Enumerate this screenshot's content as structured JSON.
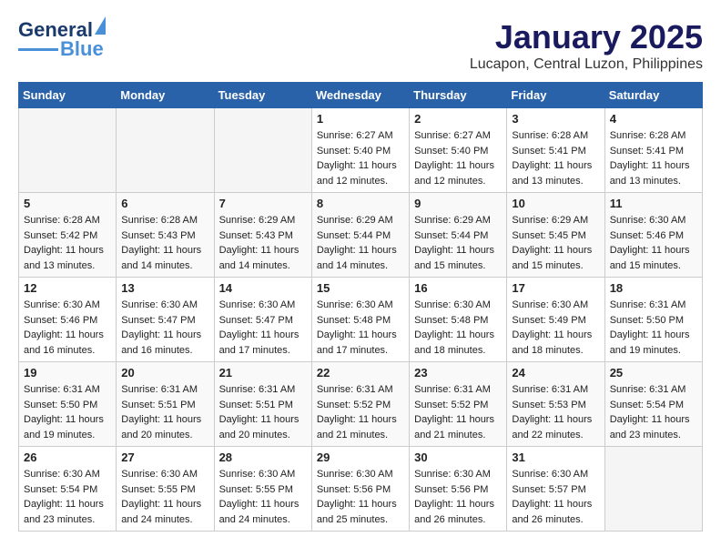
{
  "header": {
    "logo": {
      "general": "General",
      "blue": "Blue"
    },
    "title": "January 2025",
    "location": "Lucapon, Central Luzon, Philippines"
  },
  "weekdays": [
    "Sunday",
    "Monday",
    "Tuesday",
    "Wednesday",
    "Thursday",
    "Friday",
    "Saturday"
  ],
  "weeks": [
    [
      {
        "day": "",
        "empty": true
      },
      {
        "day": "",
        "empty": true
      },
      {
        "day": "",
        "empty": true
      },
      {
        "day": "1",
        "sunrise": "6:27 AM",
        "sunset": "5:40 PM",
        "daylight": "11 hours and 12 minutes."
      },
      {
        "day": "2",
        "sunrise": "6:27 AM",
        "sunset": "5:40 PM",
        "daylight": "11 hours and 12 minutes."
      },
      {
        "day": "3",
        "sunrise": "6:28 AM",
        "sunset": "5:41 PM",
        "daylight": "11 hours and 13 minutes."
      },
      {
        "day": "4",
        "sunrise": "6:28 AM",
        "sunset": "5:41 PM",
        "daylight": "11 hours and 13 minutes."
      }
    ],
    [
      {
        "day": "5",
        "sunrise": "6:28 AM",
        "sunset": "5:42 PM",
        "daylight": "11 hours and 13 minutes."
      },
      {
        "day": "6",
        "sunrise": "6:28 AM",
        "sunset": "5:43 PM",
        "daylight": "11 hours and 14 minutes."
      },
      {
        "day": "7",
        "sunrise": "6:29 AM",
        "sunset": "5:43 PM",
        "daylight": "11 hours and 14 minutes."
      },
      {
        "day": "8",
        "sunrise": "6:29 AM",
        "sunset": "5:44 PM",
        "daylight": "11 hours and 14 minutes."
      },
      {
        "day": "9",
        "sunrise": "6:29 AM",
        "sunset": "5:44 PM",
        "daylight": "11 hours and 15 minutes."
      },
      {
        "day": "10",
        "sunrise": "6:29 AM",
        "sunset": "5:45 PM",
        "daylight": "11 hours and 15 minutes."
      },
      {
        "day": "11",
        "sunrise": "6:30 AM",
        "sunset": "5:46 PM",
        "daylight": "11 hours and 15 minutes."
      }
    ],
    [
      {
        "day": "12",
        "sunrise": "6:30 AM",
        "sunset": "5:46 PM",
        "daylight": "11 hours and 16 minutes."
      },
      {
        "day": "13",
        "sunrise": "6:30 AM",
        "sunset": "5:47 PM",
        "daylight": "11 hours and 16 minutes."
      },
      {
        "day": "14",
        "sunrise": "6:30 AM",
        "sunset": "5:47 PM",
        "daylight": "11 hours and 17 minutes."
      },
      {
        "day": "15",
        "sunrise": "6:30 AM",
        "sunset": "5:48 PM",
        "daylight": "11 hours and 17 minutes."
      },
      {
        "day": "16",
        "sunrise": "6:30 AM",
        "sunset": "5:48 PM",
        "daylight": "11 hours and 18 minutes."
      },
      {
        "day": "17",
        "sunrise": "6:30 AM",
        "sunset": "5:49 PM",
        "daylight": "11 hours and 18 minutes."
      },
      {
        "day": "18",
        "sunrise": "6:31 AM",
        "sunset": "5:50 PM",
        "daylight": "11 hours and 19 minutes."
      }
    ],
    [
      {
        "day": "19",
        "sunrise": "6:31 AM",
        "sunset": "5:50 PM",
        "daylight": "11 hours and 19 minutes."
      },
      {
        "day": "20",
        "sunrise": "6:31 AM",
        "sunset": "5:51 PM",
        "daylight": "11 hours and 20 minutes."
      },
      {
        "day": "21",
        "sunrise": "6:31 AM",
        "sunset": "5:51 PM",
        "daylight": "11 hours and 20 minutes."
      },
      {
        "day": "22",
        "sunrise": "6:31 AM",
        "sunset": "5:52 PM",
        "daylight": "11 hours and 21 minutes."
      },
      {
        "day": "23",
        "sunrise": "6:31 AM",
        "sunset": "5:52 PM",
        "daylight": "11 hours and 21 minutes."
      },
      {
        "day": "24",
        "sunrise": "6:31 AM",
        "sunset": "5:53 PM",
        "daylight": "11 hours and 22 minutes."
      },
      {
        "day": "25",
        "sunrise": "6:31 AM",
        "sunset": "5:54 PM",
        "daylight": "11 hours and 23 minutes."
      }
    ],
    [
      {
        "day": "26",
        "sunrise": "6:30 AM",
        "sunset": "5:54 PM",
        "daylight": "11 hours and 23 minutes."
      },
      {
        "day": "27",
        "sunrise": "6:30 AM",
        "sunset": "5:55 PM",
        "daylight": "11 hours and 24 minutes."
      },
      {
        "day": "28",
        "sunrise": "6:30 AM",
        "sunset": "5:55 PM",
        "daylight": "11 hours and 24 minutes."
      },
      {
        "day": "29",
        "sunrise": "6:30 AM",
        "sunset": "5:56 PM",
        "daylight": "11 hours and 25 minutes."
      },
      {
        "day": "30",
        "sunrise": "6:30 AM",
        "sunset": "5:56 PM",
        "daylight": "11 hours and 26 minutes."
      },
      {
        "day": "31",
        "sunrise": "6:30 AM",
        "sunset": "5:57 PM",
        "daylight": "11 hours and 26 minutes."
      },
      {
        "day": "",
        "empty": true
      }
    ]
  ]
}
